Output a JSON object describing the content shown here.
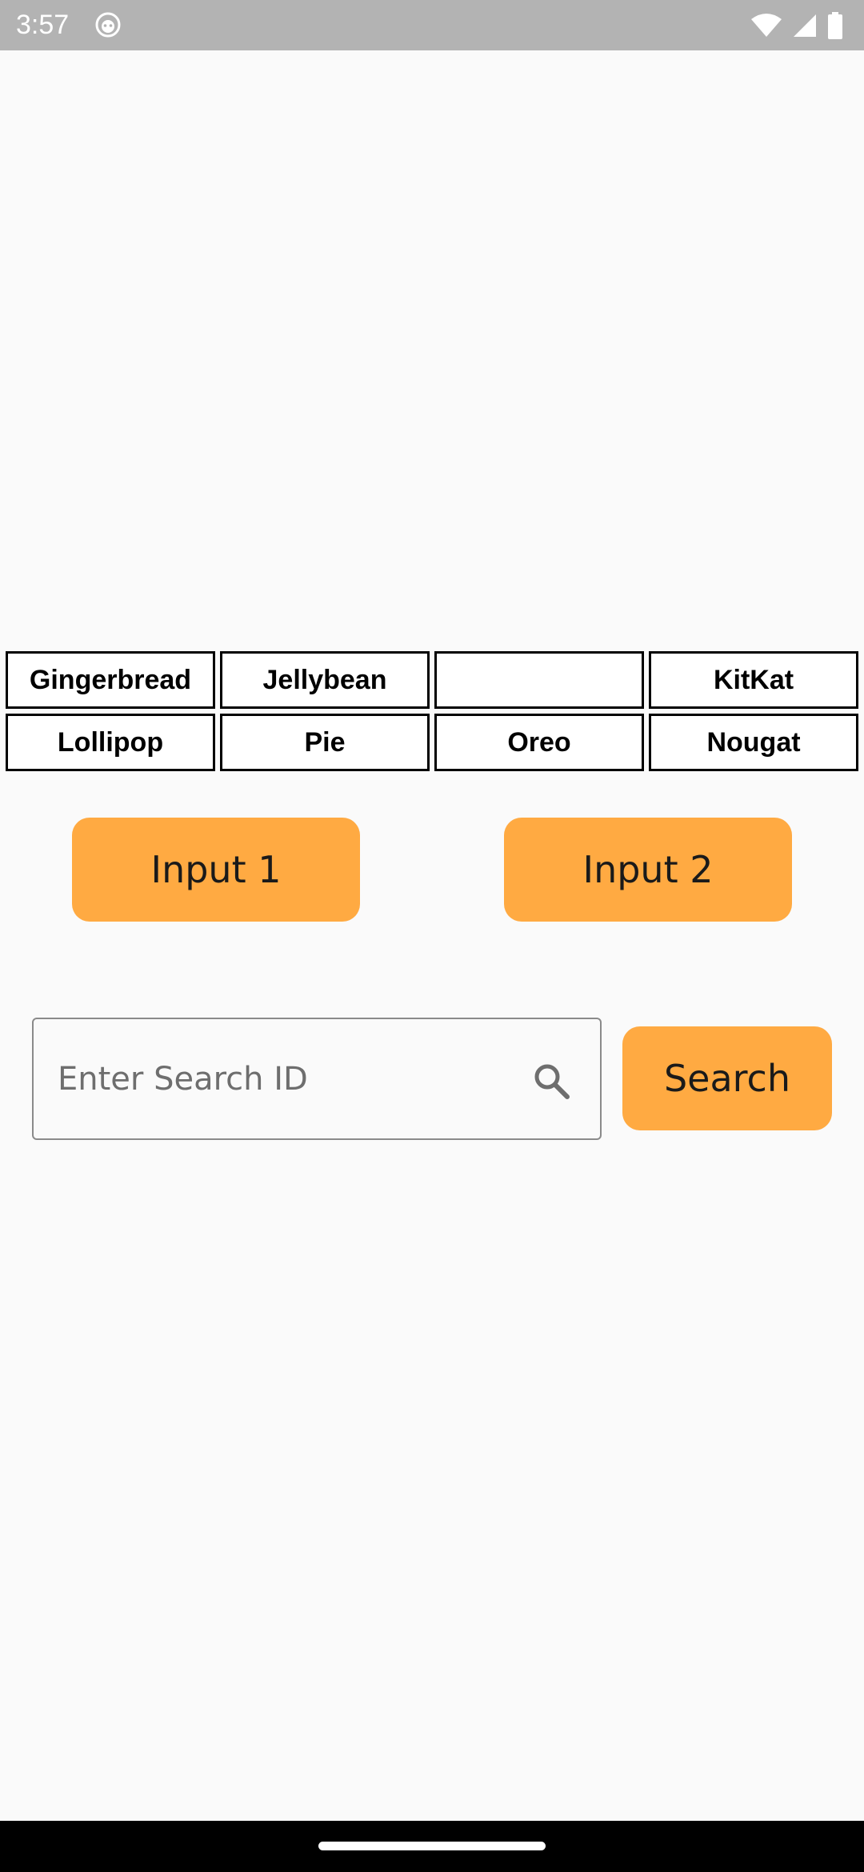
{
  "status_bar": {
    "time": "3:57",
    "icons": [
      "app-notification-icon",
      "wifi-icon",
      "signal-icon",
      "battery-icon"
    ]
  },
  "version_grid": {
    "rows": [
      [
        "Gingerbread",
        "Jellybean",
        "",
        "KitKat"
      ],
      [
        "Lollipop",
        "Pie",
        "Oreo",
        "Nougat"
      ]
    ]
  },
  "buttons": {
    "input1_label": "Input 1",
    "input2_label": "Input 2",
    "search_label": "Search"
  },
  "search": {
    "placeholder": "Enter Search ID",
    "value": "",
    "icon": "search-icon"
  },
  "colors": {
    "accent": "#ffaa42",
    "status_bar": "#b3b3b3",
    "background": "#fafafa"
  }
}
